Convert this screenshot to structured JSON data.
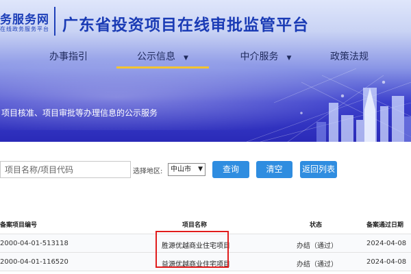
{
  "header": {
    "logo_text": "政务服务网",
    "logo_visible": "务服务网",
    "logo_sub": "在线政务服务平台",
    "title": "广东省投资项目在线审批监管平台"
  },
  "nav": {
    "items": [
      {
        "label": "办事指引",
        "has_caret": false,
        "active": false
      },
      {
        "label": "公示信息",
        "has_caret": true,
        "active": true
      },
      {
        "label": "中介服务",
        "has_caret": true,
        "active": false
      },
      {
        "label": "政策法规",
        "has_caret": false,
        "active": false
      }
    ],
    "caret": "▼"
  },
  "banner": {
    "tagline": "项目核准、项目审批等办理信息的公示服务"
  },
  "search": {
    "placeholder": "项目名称/项目代码",
    "region_label": "选择地区:",
    "region_value": "中山市",
    "region_arrow": "▼",
    "query_button": "查询",
    "clear_button": "清空",
    "back_button": "返回列表"
  },
  "table": {
    "columns": [
      "备案项目编号",
      "项目名称",
      "状态",
      "备案通过日期"
    ],
    "rows": [
      {
        "code": "2000-04-01-513118",
        "name": "胜源优越商业住宅项目",
        "status": "办结（通过）",
        "date": "2024-04-08"
      },
      {
        "code": "2000-04-01-116520",
        "name": "益源优越商业住宅项目",
        "status": "办结（通过）",
        "date": "2024-04-08"
      }
    ]
  },
  "colors": {
    "brand_blue": "#1a3bb5",
    "nav_active_underline": "#f4c430",
    "button_blue": "#2f8de0",
    "highlight_red": "#e11b1b"
  }
}
